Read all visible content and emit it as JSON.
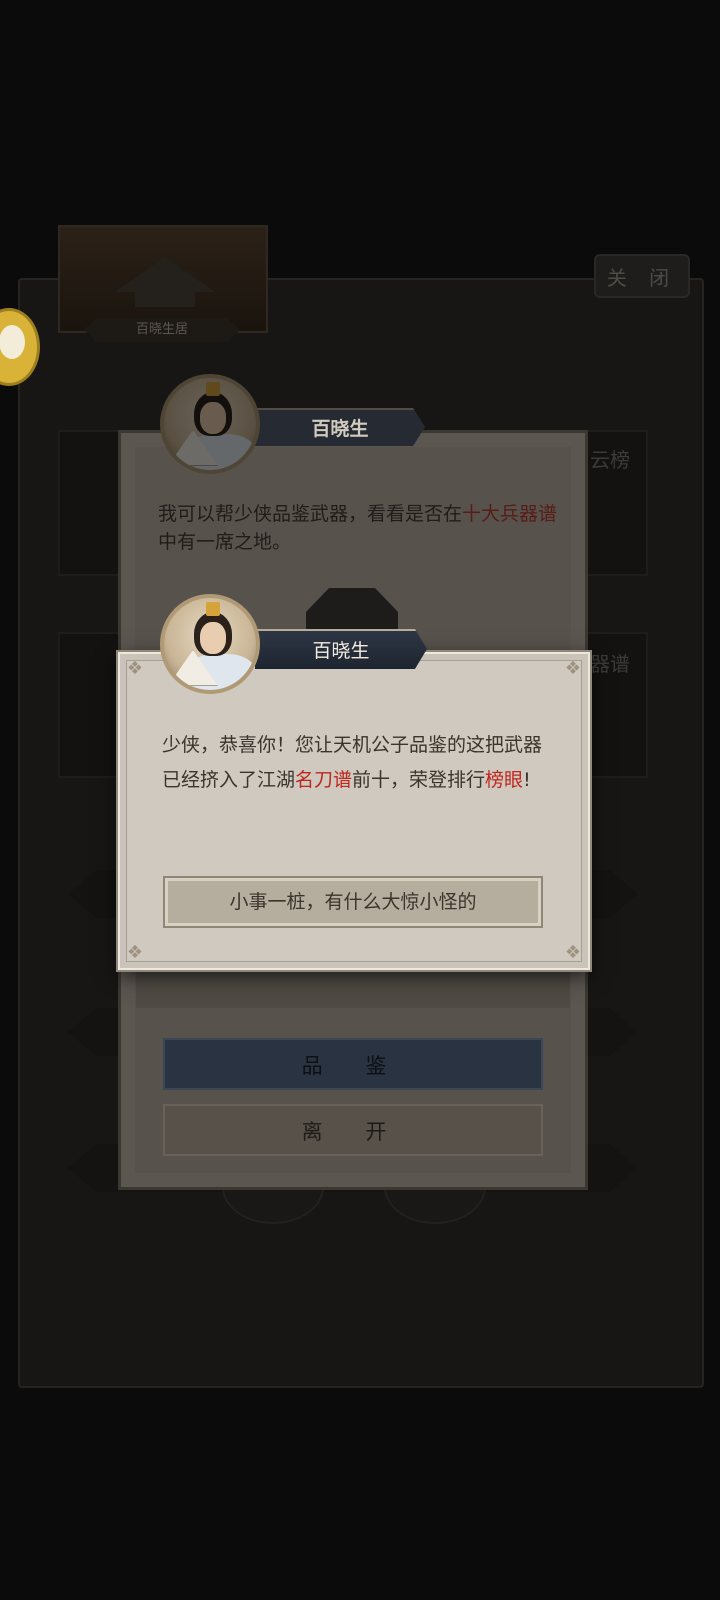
{
  "base": {
    "building_name": "百晓生居",
    "close_label": "关 闭",
    "side_label_1": "云榜",
    "side_label_2": "器谱"
  },
  "dialog_1": {
    "speaker": "百晓生",
    "text_before": "我可以帮少侠品鉴武器，看看是否在",
    "text_highlight": "十大兵器谱",
    "text_after": "中有一席之地。",
    "appraise_label": "品 鉴",
    "leave_label": "离 开"
  },
  "dialog_2": {
    "speaker": "百晓生",
    "text_part1": "少侠，恭喜你！您让天机公子品鉴的这把武器已经挤入了江湖",
    "text_highlight1": "名刀谱",
    "text_part2": "前十，荣登排行",
    "text_highlight2": "榜眼",
    "text_part3": "!",
    "confirm_label": "小事一桩，有什么大惊小怪的"
  },
  "colors": {
    "highlight_red": "#c0261d",
    "nameplate_blue": "#262b33",
    "dialog_parchment": "#cfc9bf"
  }
}
